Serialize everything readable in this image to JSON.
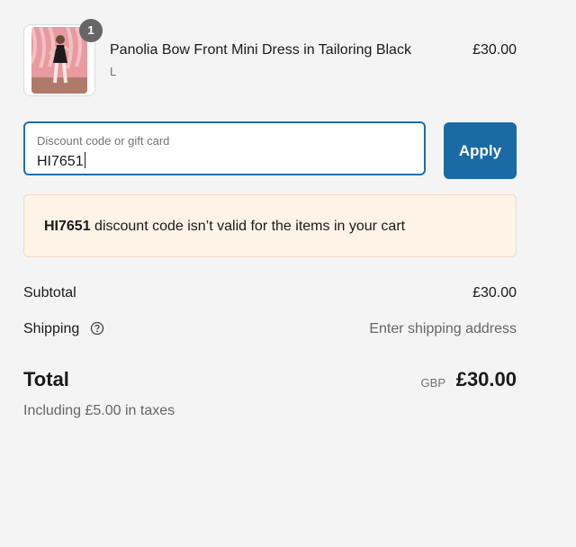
{
  "product": {
    "quantity": "1",
    "name": "Panolia Bow Front Mini Dress in Tailoring Black",
    "variant": "L",
    "price": "£30.00",
    "image": "product-photo-pink-backdrop"
  },
  "discount": {
    "placeholder": "Discount code or gift card",
    "value": "HI7651",
    "apply_label": "Apply",
    "accent_color": "#1a6aa6"
  },
  "error": {
    "code": "HI7651",
    "message": " discount code isn’t valid for the items in your cart"
  },
  "summary": {
    "subtotal_label": "Subtotal",
    "subtotal_value": "£30.00",
    "shipping_label": "Shipping",
    "shipping_value": "Enter shipping address",
    "total_label": "Total",
    "currency": "GBP",
    "total_value": "£30.00",
    "taxes_note": "Including £5.00 in taxes"
  }
}
